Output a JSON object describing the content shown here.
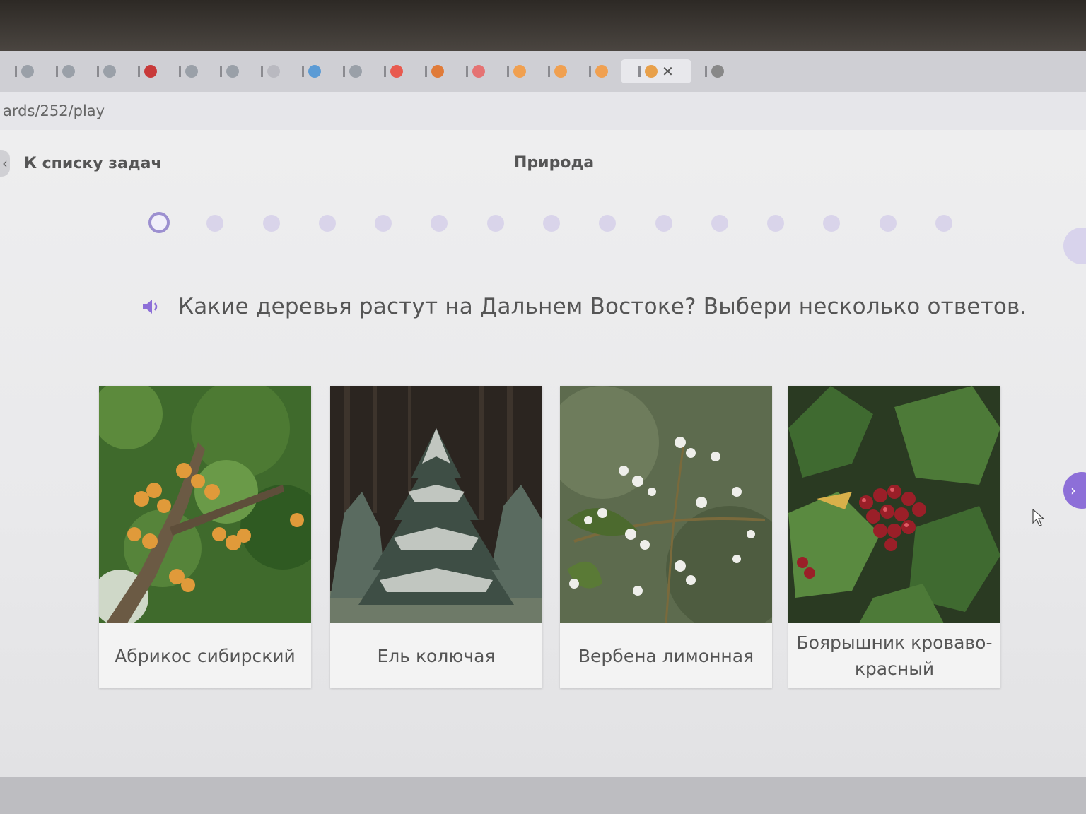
{
  "browser": {
    "url_fragment": "ards/252/play",
    "active_tab_close": "✕",
    "tab_favicon_colors": [
      "#9aa0a8",
      "#9aa0a8",
      "#9aa0a8",
      "#c83a3a",
      "#9aa0a8",
      "#9aa0a8",
      "#b9b9c0",
      "#5b9bd5",
      "#9aa0a8",
      "#e85a4f",
      "#e07b39",
      "#e57373",
      "#f0a050",
      "#f0a050",
      "#f0a050",
      "#e8a04a",
      "#888888"
    ]
  },
  "header": {
    "back_label": "К списку задач",
    "title": "Природа"
  },
  "progress": {
    "total": 15,
    "current": 1
  },
  "question": {
    "text": "Какие деревья растут на Дальнем Востоке? Выбери несколько ответов."
  },
  "options": [
    {
      "label": "Абрикос сибирский",
      "icon": "apricot-tree-photo"
    },
    {
      "label": "Ель колючая",
      "icon": "spruce-tree-photo"
    },
    {
      "label": "Вербена лимонная",
      "icon": "verbena-photo"
    },
    {
      "label": "Боярышник кроваво-красный",
      "icon": "hawthorn-photo"
    }
  ],
  "colors": {
    "accent": "#9c8fd0",
    "dot_inactive": "#d9d4ea",
    "next_button": "#8d6fd8"
  }
}
